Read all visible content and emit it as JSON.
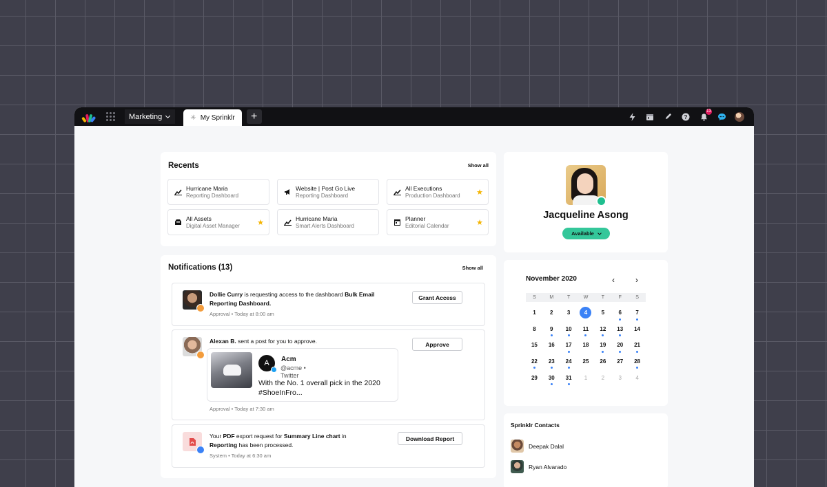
{
  "topbar": {
    "workspace": "Marketing",
    "active_tab": "My Sprinklr",
    "notification_count": "13"
  },
  "colors": {
    "accent": "#3b82f6",
    "available": "#34c79a",
    "star": "#f4b400",
    "badge": "#e3195e"
  },
  "recents": {
    "title": "Recents",
    "show_all": "Show all",
    "items": [
      {
        "title": "Hurricane Maria",
        "subtitle": "Reporting Dashboard",
        "icon": "chart-icon",
        "starred": false
      },
      {
        "title": "Website | Post Go Live",
        "subtitle": "Reporting Dashboard",
        "icon": "megaphone-icon",
        "starred": false
      },
      {
        "title": "All Executions",
        "subtitle": "Production Dashboard",
        "icon": "chart-icon",
        "starred": true
      },
      {
        "title": "All Assets",
        "subtitle": "Digital Asset Manager",
        "icon": "inbox-icon",
        "starred": true
      },
      {
        "title": "Hurricane Maria",
        "subtitle": "Smart Alerts Dashboard",
        "icon": "chart-icon",
        "starred": false
      },
      {
        "title": "Planner",
        "subtitle": "Editorial Calendar",
        "icon": "calendar-icon",
        "starred": true
      }
    ]
  },
  "notifications": {
    "title": "Notifications (13)",
    "show_all": "Show all",
    "items": [
      {
        "actor": "Dollie Curry",
        "text_a": " is requesting access to the dashboard ",
        "target": "Bulk Email Reporting Dashboard.",
        "meta": "Approval • Today at 8:00 am",
        "action": "Grant Access"
      },
      {
        "actor": "Alexan B.",
        "text_a": " sent a post for you to approve.",
        "meta": "Approval • Today at 7:30 am",
        "action": "Approve",
        "post": {
          "avatar_letter": "A",
          "name": "Acm",
          "handle": "@acme • Twitter",
          "text": "With the No. 1 overall pick in the 2020 #ShoeInFro..."
        }
      },
      {
        "text_a": "Your ",
        "bold_a": "PDF",
        "text_b": " export request for ",
        "bold_b": "Summary Line chart",
        "text_c": " in ",
        "bold_c": "Reporting",
        "text_d": " has been processed.",
        "meta": "System • Today at  6:30 am",
        "action": "Download Report"
      }
    ]
  },
  "profile": {
    "name": "Jacqueline Asong",
    "status": "Available"
  },
  "calendar": {
    "month": "November 2020",
    "prev": "‹",
    "next": "›",
    "weekdays": [
      "S",
      "M",
      "T",
      "W",
      "T",
      "F",
      "S"
    ],
    "today": "4",
    "days": [
      {
        "d": "1",
        "dot": false
      },
      {
        "d": "2",
        "dot": false
      },
      {
        "d": "3",
        "dot": false
      },
      {
        "d": "4",
        "dot": false,
        "today": true
      },
      {
        "d": "5",
        "dot": false
      },
      {
        "d": "6",
        "dot": true
      },
      {
        "d": "7",
        "dot": true
      },
      {
        "d": "8",
        "dot": false
      },
      {
        "d": "9",
        "dot": true
      },
      {
        "d": "10",
        "dot": true
      },
      {
        "d": "11",
        "dot": true
      },
      {
        "d": "12",
        "dot": true
      },
      {
        "d": "13",
        "dot": true
      },
      {
        "d": "14",
        "dot": false
      },
      {
        "d": "15",
        "dot": false
      },
      {
        "d": "16",
        "dot": false
      },
      {
        "d": "17",
        "dot": true
      },
      {
        "d": "18",
        "dot": false
      },
      {
        "d": "19",
        "dot": true
      },
      {
        "d": "20",
        "dot": true
      },
      {
        "d": "21",
        "dot": true
      },
      {
        "d": "22",
        "dot": true
      },
      {
        "d": "23",
        "dot": true
      },
      {
        "d": "24",
        "dot": true
      },
      {
        "d": "25",
        "dot": false
      },
      {
        "d": "26",
        "dot": false
      },
      {
        "d": "27",
        "dot": false
      },
      {
        "d": "28",
        "dot": true
      },
      {
        "d": "29",
        "dot": false
      },
      {
        "d": "30",
        "dot": true
      },
      {
        "d": "31",
        "dot": true
      },
      {
        "d": "1",
        "dot": false,
        "muted": true
      },
      {
        "d": "2",
        "dot": false,
        "muted": true
      },
      {
        "d": "3",
        "dot": false,
        "muted": true
      },
      {
        "d": "4",
        "dot": false,
        "muted": true
      }
    ]
  },
  "contacts": {
    "title": "Sprinklr Contacts",
    "items": [
      {
        "name": "Deepak Dalal"
      },
      {
        "name": "Ryan Alvarado"
      }
    ]
  }
}
